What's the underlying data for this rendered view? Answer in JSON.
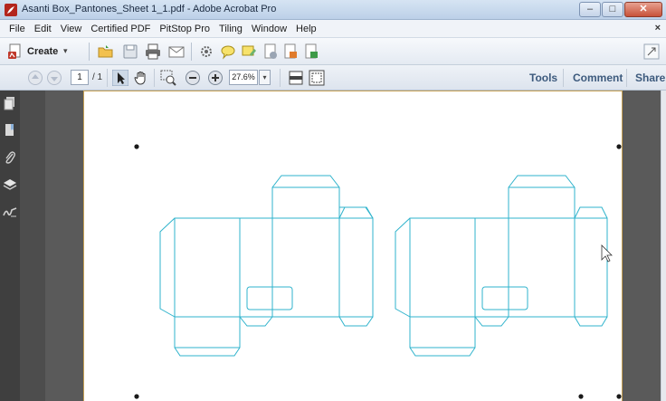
{
  "window": {
    "title": "Asanti Box_Pantones_Sheet 1_1.pdf - Adobe Acrobat Pro",
    "minimize_glyph": "–",
    "maximize_glyph": "□",
    "close_glyph": "✕"
  },
  "menu": {
    "items": [
      "File",
      "Edit",
      "View",
      "Certified PDF",
      "PitStop Pro",
      "Tiling",
      "Window",
      "Help"
    ],
    "close_glyph": "×"
  },
  "toolbar": {
    "create_label": "Create",
    "create_caret": "▾"
  },
  "nav": {
    "current_page": "1",
    "total_pages": "/ 1",
    "zoom": "27.6%",
    "zoom_caret": "▾"
  },
  "right_links": {
    "tools": "Tools",
    "comment": "Comment",
    "share": "Share"
  },
  "colors": {
    "dieline": "#2fb3cc",
    "page_border": "#c6a155",
    "link": "#3d5a7d"
  }
}
